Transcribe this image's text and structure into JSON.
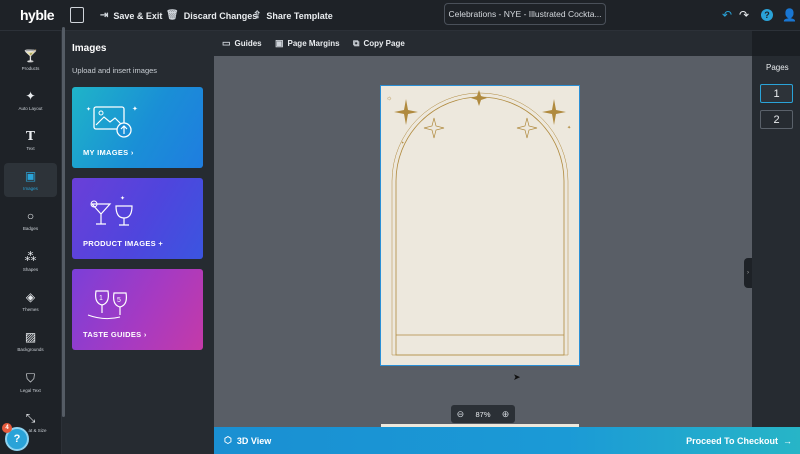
{
  "topbar": {
    "logo": "hyble",
    "save_exit": "Save & Exit",
    "discard": "Discard Changes",
    "share": "Share Template",
    "doc_title": "Celebrations - NYE - Illustrated Cockta...",
    "help": "?"
  },
  "rail": {
    "items": [
      {
        "label": "Products",
        "icon": "cocktail-glass-icon",
        "glyph": "🍸"
      },
      {
        "label": "Auto Layout",
        "icon": "magic-wand-icon",
        "glyph": "✦"
      },
      {
        "label": "Text",
        "icon": "text-icon",
        "glyph": "T"
      },
      {
        "label": "Images",
        "icon": "image-icon",
        "glyph": "▣"
      },
      {
        "label": "Badges",
        "icon": "badge-icon",
        "glyph": "○"
      },
      {
        "label": "Shapes",
        "icon": "shapes-icon",
        "glyph": "⁂"
      },
      {
        "label": "Themes",
        "icon": "themes-icon",
        "glyph": "◈"
      },
      {
        "label": "Backgrounds",
        "icon": "background-icon",
        "glyph": "▨"
      },
      {
        "label": "Legal Text",
        "icon": "shield-icon",
        "glyph": "⛉"
      },
      {
        "label": "at & Size",
        "icon": "resize-icon",
        "glyph": "⤡"
      }
    ]
  },
  "panel": {
    "title": "Images",
    "subtitle": "Upload and insert images",
    "cards": [
      {
        "label": "MY IMAGES",
        "suffix": "›"
      },
      {
        "label": "PRODUCT IMAGES",
        "suffix": "+"
      },
      {
        "label": "TASTE GUIDES",
        "suffix": "›"
      }
    ]
  },
  "subbar": {
    "guides": "Guides",
    "margins": "Page Margins",
    "copy": "Copy Page"
  },
  "zoom": {
    "level": "87%"
  },
  "pages": {
    "title": "Pages",
    "items": [
      "1",
      "2"
    ],
    "selected": "1"
  },
  "bottombar": {
    "view3d": "3D View",
    "checkout": "Proceed To Checkout"
  },
  "help_bubble": {
    "badge": "4",
    "glyph": "?"
  },
  "colors": {
    "accent": "#2aa3d8",
    "gold": "#b08a3e",
    "page_bg": "#ede8dd"
  }
}
